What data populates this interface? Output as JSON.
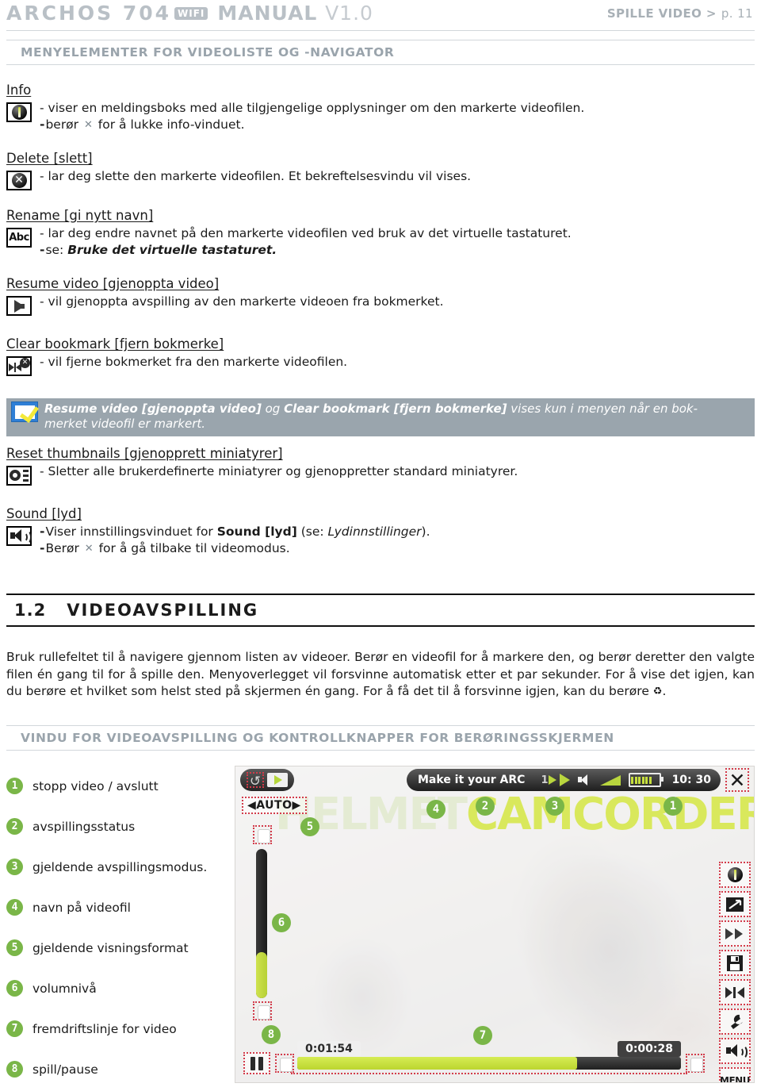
{
  "header": {
    "brand": "ARCHOS 704",
    "wifi": "WIFI",
    "manual": "MANUAL",
    "version": "V1.0",
    "breadcrumb": "SPILLE VIDEO >",
    "page": "p. 11"
  },
  "section_heading": "MENYELEMENTER FOR VIDEOLISTE OG -NAVIGATOR",
  "entries": [
    {
      "title": "Info",
      "icon": "info-icon",
      "lines": [
        "- viser en meldingsboks med alle tilgjengelige opplysninger om den markerte videofilen.",
        "- berør ✕ for å lukke info-vinduet."
      ]
    },
    {
      "title": "Delete [slett]",
      "icon": "delete-icon",
      "lines": [
        "- lar deg slette den markerte videofilen. Et bekreftelsesvindu vil vises."
      ]
    },
    {
      "title": "Rename [gi nytt navn]",
      "icon": "rename-abc-icon",
      "lines": [
        "- lar deg endre navnet på den markerte videofilen ved bruk av det virtuelle tastaturet.",
        "- se: Bruke det virtuelle tastaturet."
      ],
      "italic_bold_tail": "Bruke det virtuelle tastaturet."
    },
    {
      "title": "Resume video [gjenoppta video]",
      "icon": "resume-arrow-icon",
      "lines": [
        "- vil gjenoppta avspilling av den markerte videoen fra bokmerket."
      ]
    },
    {
      "title": "Clear bookmark [fjern bokmerke]",
      "icon": "clear-bookmark-icon",
      "lines": [
        "- vil fjerne bokmerket fra den markerte videofilen."
      ]
    },
    {
      "title": "Reset thumbnails [gjenopprett miniatyrer]",
      "icon": "reset-thumbnails-icon",
      "lines": [
        "- Sletter alle brukerdefinerte miniatyrer og gjenoppretter standard miniatyrer."
      ]
    },
    {
      "title": "Sound [lyd]",
      "icon": "sound-icon",
      "lines": [
        "- Viser innstillingsvinduet for Sound [lyd] (se: Lydinnstillinger).",
        "- Berør ✕ for å gå tilbake til videomodus."
      ]
    }
  ],
  "note": {
    "icon": "note-check-icon",
    "bold1": "Resume video [gjenoppta video]",
    "mid": " og ",
    "bold2": "Clear bookmark [fjern bokmerke]",
    "tail": " vises kun i menyen når en bok-",
    "line2": "merket videofil er markert."
  },
  "section2": {
    "number": "1.2",
    "title": "VIDEOAVSPILLING",
    "paragraph": "Bruk rullefeltet til å navigere gjennom listen av videoer. Berør en videofil for å markere den, og berør deretter den valgte filen én gang til for å spille den. Menyoverlegget vil forsvinne automatisk etter et par sekunder. For å vise det igjen, kan du berøre et hvilket som helst sted på skjermen én gang. For å få det til å forsvinne igjen, kan du berøre",
    "paragraph_tail_icon": "♻"
  },
  "section3_heading": "VINDU FOR VIDEOAVSPILLING OG KONTROLLKNAPPER FOR BERØRINGSSKJERMEN",
  "legend": [
    {
      "n": "1",
      "label": "stopp video / avslutt"
    },
    {
      "n": "2",
      "label": "avspillingsstatus"
    },
    {
      "n": "3",
      "label": "gjeldende avspillingsmodus."
    },
    {
      "n": "4",
      "label": "navn på videofil"
    },
    {
      "n": "5",
      "label": "gjeldende visningsformat"
    },
    {
      "n": "6",
      "label": "volumnivå"
    },
    {
      "n": "7",
      "label": "fremdriftslinje for video"
    },
    {
      "n": "8",
      "label": "spill/pause"
    }
  ],
  "player": {
    "watermark_a": "HELMET",
    "watermark_b": "CAMCORDER",
    "video_title": "Make it your ARC",
    "mode_number": "1",
    "clock": "10: 30",
    "aspect": "◀AUTO▶",
    "time_elapsed": "0:01:54",
    "time_remaining": "0:00:28",
    "close_glyph": "✕",
    "menu_label": "MENU",
    "overlay_badges": [
      "1",
      "2",
      "3",
      "4",
      "5",
      "6",
      "7",
      "8"
    ],
    "sidebar_icons": [
      "info-icon",
      "fullscreen-icon",
      "fast-forward-icon",
      "save-icon",
      "bookmark-icon",
      "wrench-icon",
      "volume-icon",
      "menu-button"
    ]
  },
  "colors": {
    "accent_green": "#7ab648",
    "lcd_green": "#b9d63e",
    "header_grey": "#b9c0c6",
    "note_bg": "#9aa5ad",
    "selection_red": "#d23b4a"
  }
}
